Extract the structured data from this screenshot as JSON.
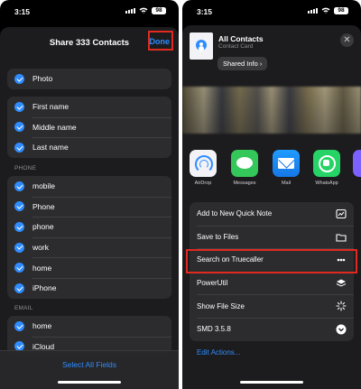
{
  "left": {
    "status": {
      "time": "3:15",
      "battery": "98"
    },
    "sheet_title": "Share 333 Contacts",
    "done_label": "Done",
    "groups": {
      "photo": [
        "Photo"
      ],
      "names": [
        "First name",
        "Middle name",
        "Last name"
      ],
      "phone_header": "PHONE",
      "phones": [
        "mobile",
        "Phone",
        "phone",
        "work",
        "home",
        "iPhone"
      ],
      "email_header": "EMAIL",
      "emails": [
        "home",
        "iCloud"
      ]
    },
    "select_all_label": "Select All Fields"
  },
  "right": {
    "status": {
      "time": "3:15",
      "battery": "98"
    },
    "header": {
      "title": "All Contacts",
      "subtitle": "Contact Card",
      "shared_info": "Shared Info ›"
    },
    "apps": [
      {
        "label": "AirDrop",
        "icon": "airdrop-icon"
      },
      {
        "label": "Messages",
        "icon": "messages-icon"
      },
      {
        "label": "Mail",
        "icon": "mail-icon"
      },
      {
        "label": "WhatsApp",
        "icon": "whatsapp-icon"
      }
    ],
    "actions": [
      {
        "label": "Add to New Quick Note",
        "icon": "quick-note-icon"
      },
      {
        "label": "Save to Files",
        "icon": "folder-icon"
      },
      {
        "label": "Search on Truecaller",
        "icon": "truecaller-icon"
      },
      {
        "label": "PowerUtil",
        "icon": "layers-icon"
      },
      {
        "label": "Show File Size",
        "icon": "sparkle-icon"
      },
      {
        "label": "SMD 3.5.8",
        "icon": "chevron-circle-icon"
      }
    ],
    "edit_actions_label": "Edit Actions..."
  },
  "colors": {
    "accent": "#2f8cff",
    "highlight": "#e02a1f",
    "sheet": "#1c1c1e",
    "cell": "#2c2c2e"
  }
}
